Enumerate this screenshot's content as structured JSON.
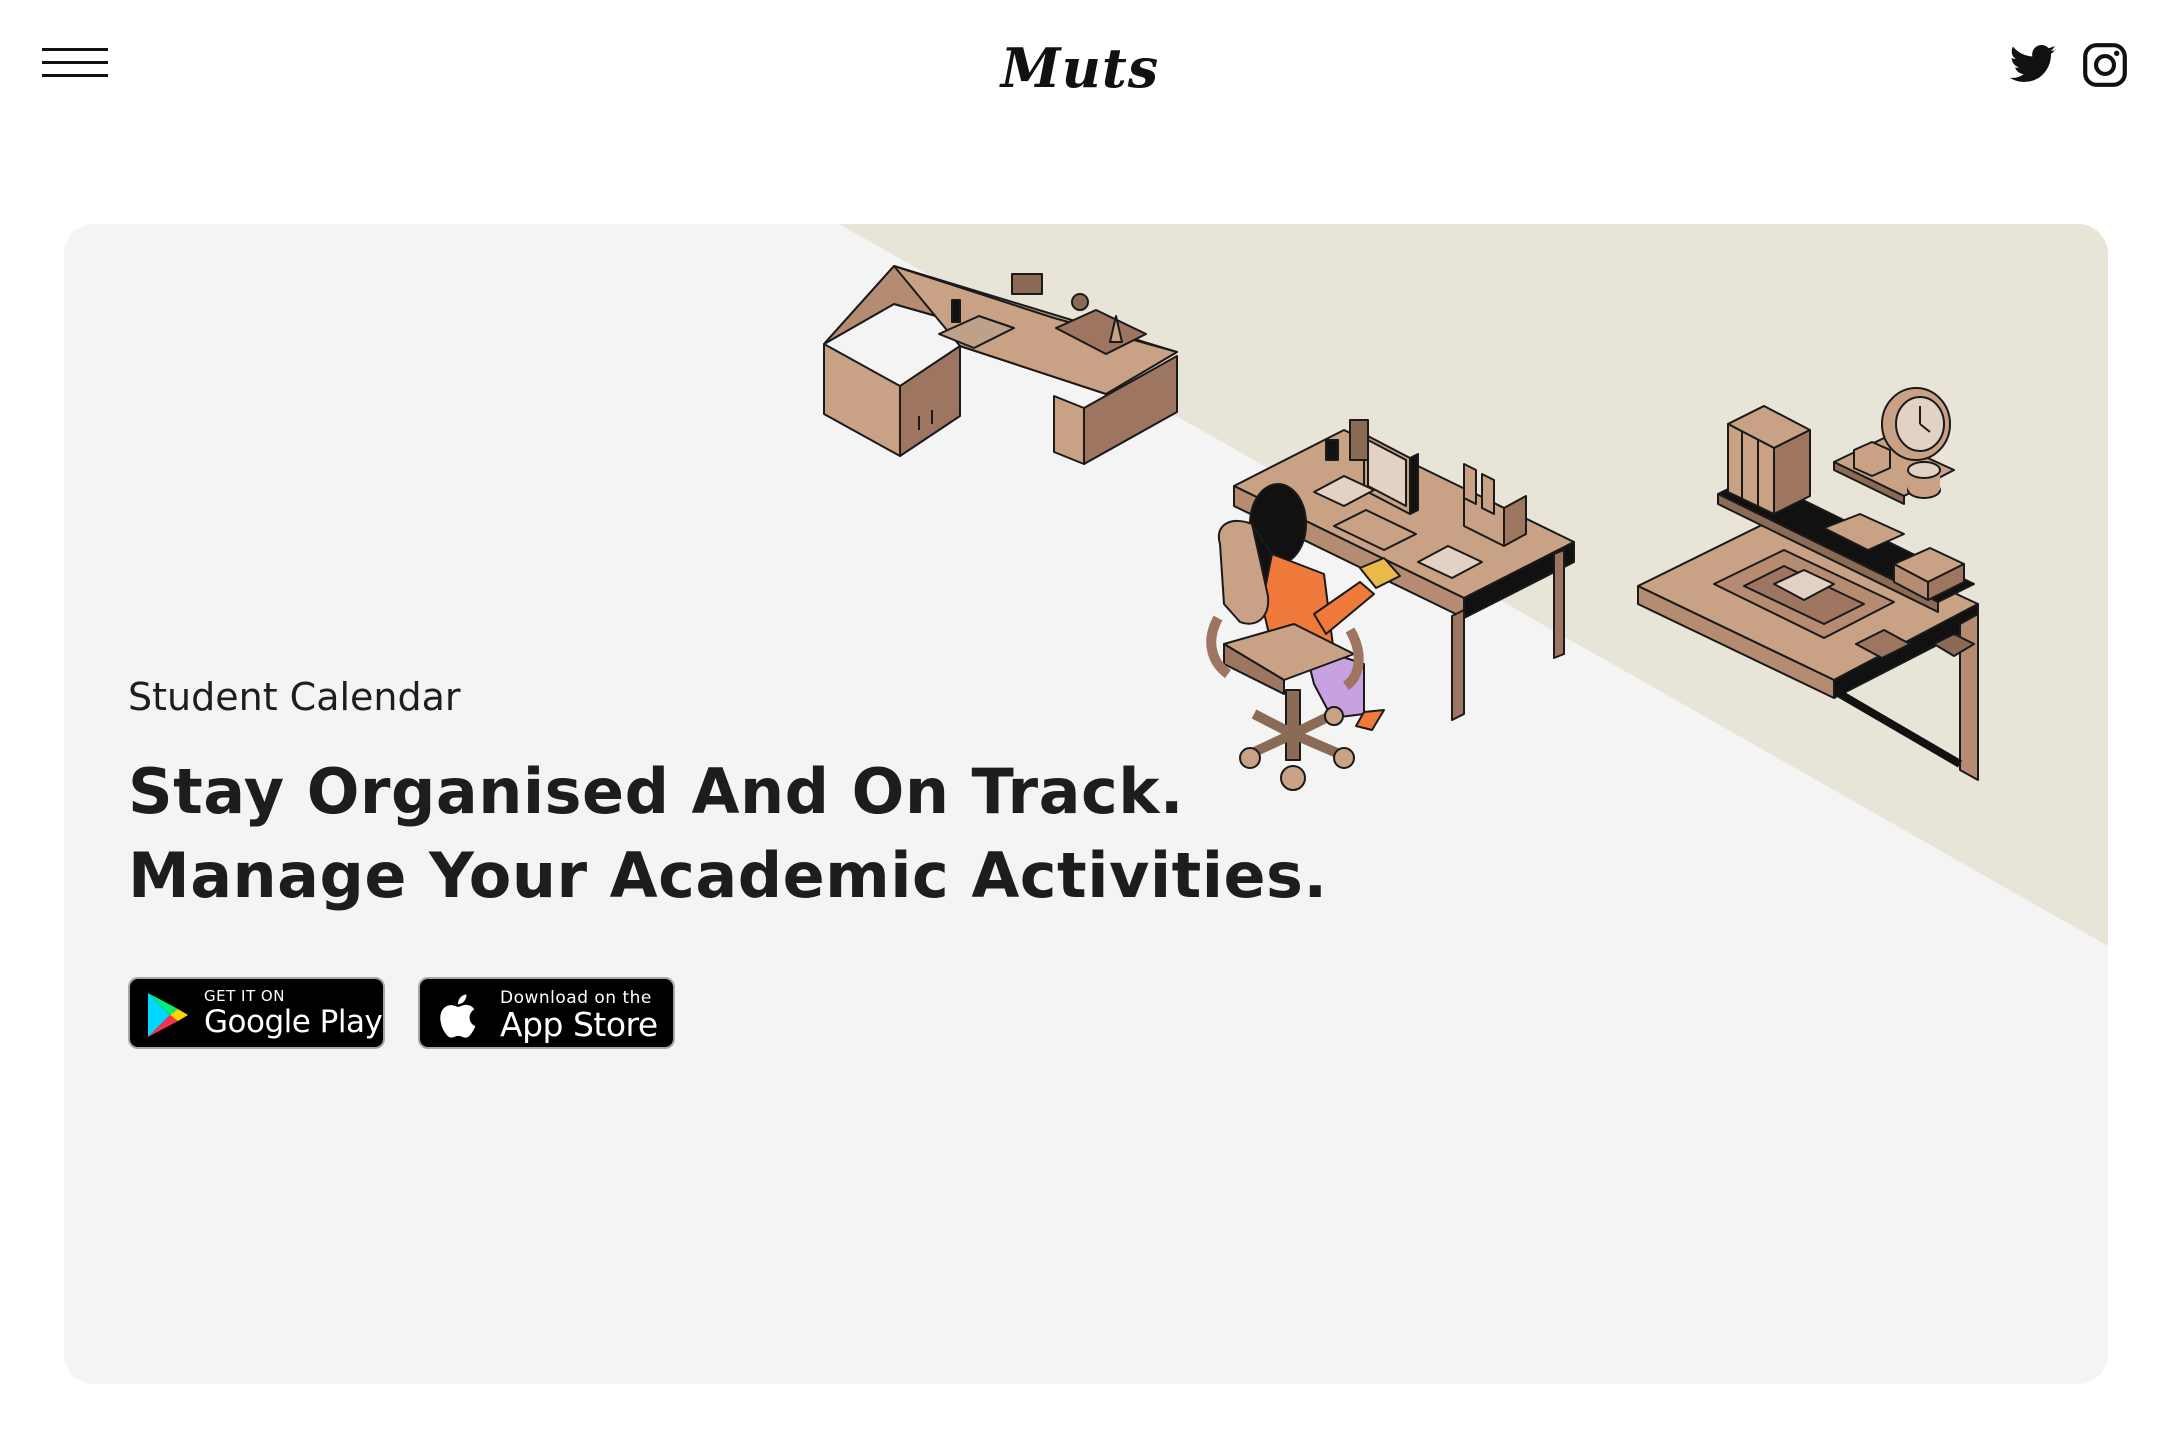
{
  "header": {
    "logo": "Muts",
    "menu_icon": "hamburger-menu-icon",
    "social": [
      {
        "name": "twitter",
        "icon": "twitter-icon"
      },
      {
        "name": "instagram",
        "icon": "instagram-icon"
      }
    ]
  },
  "hero": {
    "eyebrow": "Student Calendar",
    "headline_line1": "Stay Organised And On Track.",
    "headline_line2": "Manage Your Academic Activities.",
    "illustration_icon": "isometric-study-room-illustration",
    "colors": {
      "background": "#f4f4f4",
      "band": "#e8e4d8",
      "furniture": "#c9a185",
      "accent": "#f07a3c"
    }
  },
  "stores": {
    "google_small": "GET IT ON",
    "google_big": "Google Play",
    "apple_small": "Download on the",
    "apple_big": "App Store"
  }
}
